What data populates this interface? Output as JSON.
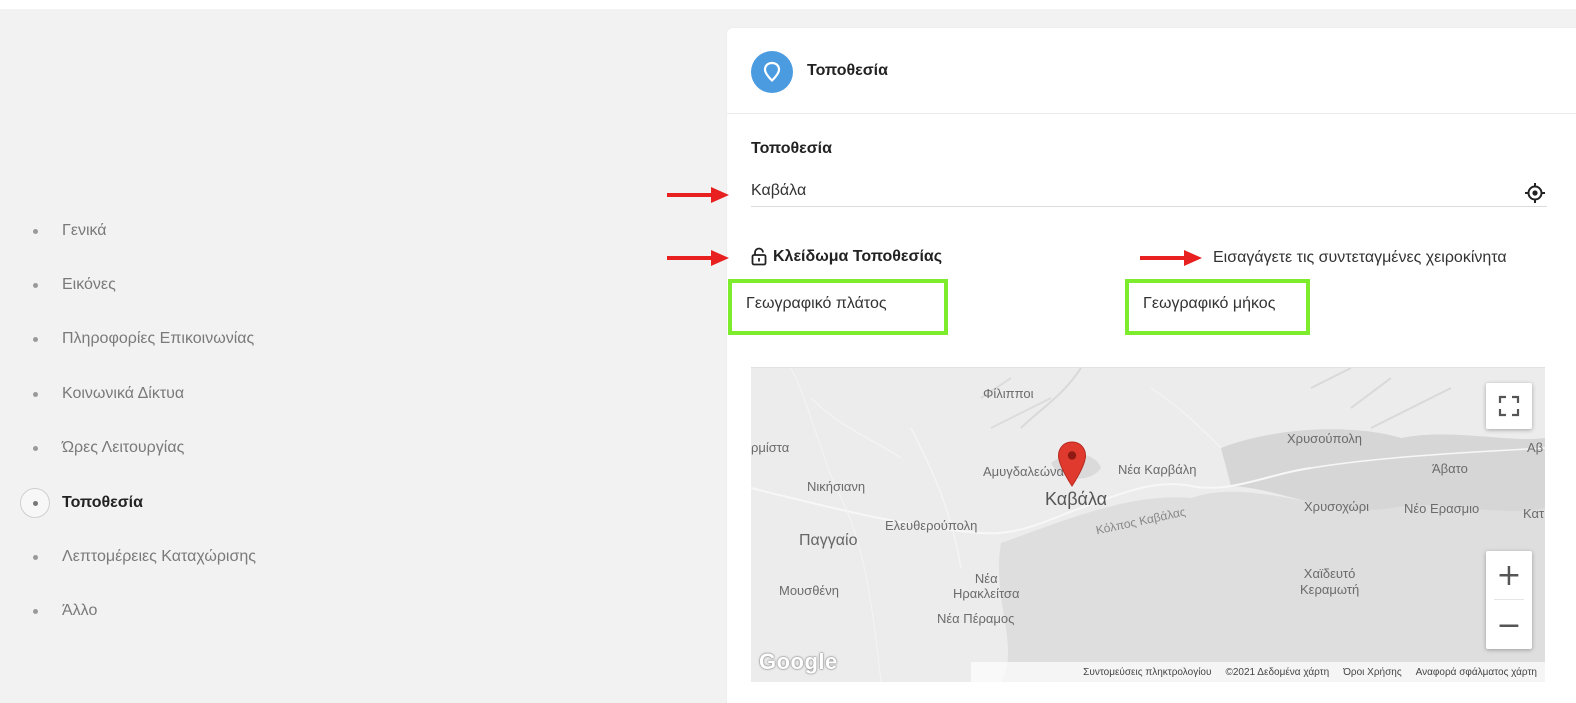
{
  "sidebar": {
    "items": [
      {
        "label": "Γενικά",
        "active": false
      },
      {
        "label": "Εικόνες",
        "active": false
      },
      {
        "label": "Πληροφορίες Επικοινωνίας",
        "active": false
      },
      {
        "label": "Κοινωνικά Δίκτυα",
        "active": false
      },
      {
        "label": "Ώρες Λειτουργίας",
        "active": false
      },
      {
        "label": "Τοποθεσία",
        "active": true
      },
      {
        "label": "Λεπτομέρειες Καταχώρισης",
        "active": false
      },
      {
        "label": "Άλλο",
        "active": false
      }
    ]
  },
  "card": {
    "title": "Τοποθεσία",
    "header_icon": "map-pin-icon",
    "accent_color": "#4a9be0"
  },
  "location": {
    "label": "Τοποθεσία",
    "value": "Καβάλα",
    "locate_icon": "crosshair-icon"
  },
  "lock": {
    "label": "Κλείδωμα Τοποθεσίας",
    "icon": "lock-icon"
  },
  "manual_entry_link": "Εισαγάγετε τις συντεταγμένες χειροκίνητα",
  "coordinates": {
    "latitude_placeholder": "Γεωγραφικό πλάτος",
    "longitude_placeholder": "Γεωγραφικό μήκος",
    "highlight_color": "#7cec2c"
  },
  "annotation_color": "#e82020",
  "map": {
    "places": {
      "filippoi": "Φίλιπποι",
      "amfipoli": "ρμίστα",
      "chrysoupoli": "Χρυσούπολη",
      "avdira": "Αβ",
      "avato": "Άβατο",
      "amygdaleonas": "Αμυγδαλεώνας",
      "nea_karvali": "Νέα Καρβάλη",
      "nikisiani": "Νικήσιανη",
      "kavala": "Καβάλα",
      "chrysochori": "Χρυσοχώρι",
      "neo_erasmio": "Νέο Ερασμιο",
      "kat": "Κατ",
      "eleftheroupoli": "Ελευθερούπολη",
      "gulf": "Κόλπος Καβάλας",
      "paggaio": "Παγγαίο",
      "nea_irakleitsa": "Νέα\nΗρακλείτσα",
      "mousthéni": "Μουσθένη",
      "haidefto": "Χαϊδευτό\nΚεραμωτή",
      "nea_peramos": "Νέα Πέραμος"
    },
    "zoom_in": "+",
    "zoom_out": "−",
    "fullscreen_icon": "fullscreen-icon",
    "marker_icon": "map-marker-icon",
    "marker_color": "#e03a2f",
    "logo": "Google",
    "attribution": {
      "shortcuts": "Συντομεύσεις πληκτρολογίου",
      "data": "©2021 Δεδομένα χάρτη",
      "terms": "Όροι Χρήσης",
      "report": "Αναφορά σφάλματος χάρτη"
    }
  }
}
